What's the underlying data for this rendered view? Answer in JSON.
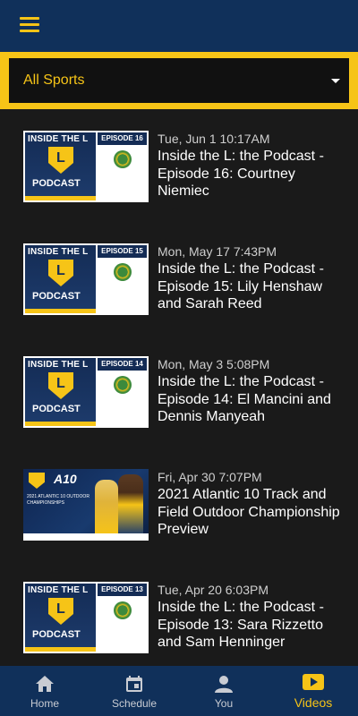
{
  "colors": {
    "navy": "#10305a",
    "gold": "#f6c417",
    "background": "#1a1a1a"
  },
  "header": {
    "menu_icon": "hamburger-menu-icon"
  },
  "filter": {
    "selected": "All Sports",
    "icon": "dropdown-caret-icon"
  },
  "videos": [
    {
      "date": "Tue, Jun 1 10:17AM",
      "title": "Inside the L: the Podcast - Episode 16: Courtney Niemiec",
      "thumb": {
        "heading": "INSIDE THE L",
        "label": "PODCAST",
        "episode": "EPISODE 16"
      }
    },
    {
      "date": "Mon, May 17 7:43PM",
      "title": "Inside the L: the Podcast - Episode 15: Lily Henshaw and Sarah Reed",
      "thumb": {
        "heading": "INSIDE THE L",
        "label": "PODCAST",
        "episode": "EPISODE 15"
      }
    },
    {
      "date": "Mon, May 3 5:08PM",
      "title": "Inside the L: the Podcast - Episode 14: El Mancini and Dennis Manyeah",
      "thumb": {
        "heading": "INSIDE THE L",
        "label": "PODCAST",
        "episode": "EPISODE 14"
      }
    },
    {
      "date": "Fri, Apr 30 7:07PM",
      "title": "2021 Atlantic 10 Track and Field Outdoor Championship Preview",
      "thumb": {
        "brand": "A10",
        "text": "2021 ATLANTIC 10 OUTDOOR CHAMPIONSHIPS"
      }
    },
    {
      "date": "Tue, Apr 20 6:03PM",
      "title": "Inside the L: the Podcast - Episode 13: Sara Rizzetto and Sam Henninger",
      "thumb": {
        "heading": "INSIDE THE L",
        "label": "PODCAST",
        "episode": "EPISODE 13"
      }
    }
  ],
  "nav": [
    {
      "label": "Home",
      "icon": "home-icon",
      "active": false
    },
    {
      "label": "Schedule",
      "icon": "calendar-icon",
      "active": false
    },
    {
      "label": "You",
      "icon": "person-icon",
      "active": false
    },
    {
      "label": "Videos",
      "icon": "video-play-icon",
      "active": true
    }
  ]
}
